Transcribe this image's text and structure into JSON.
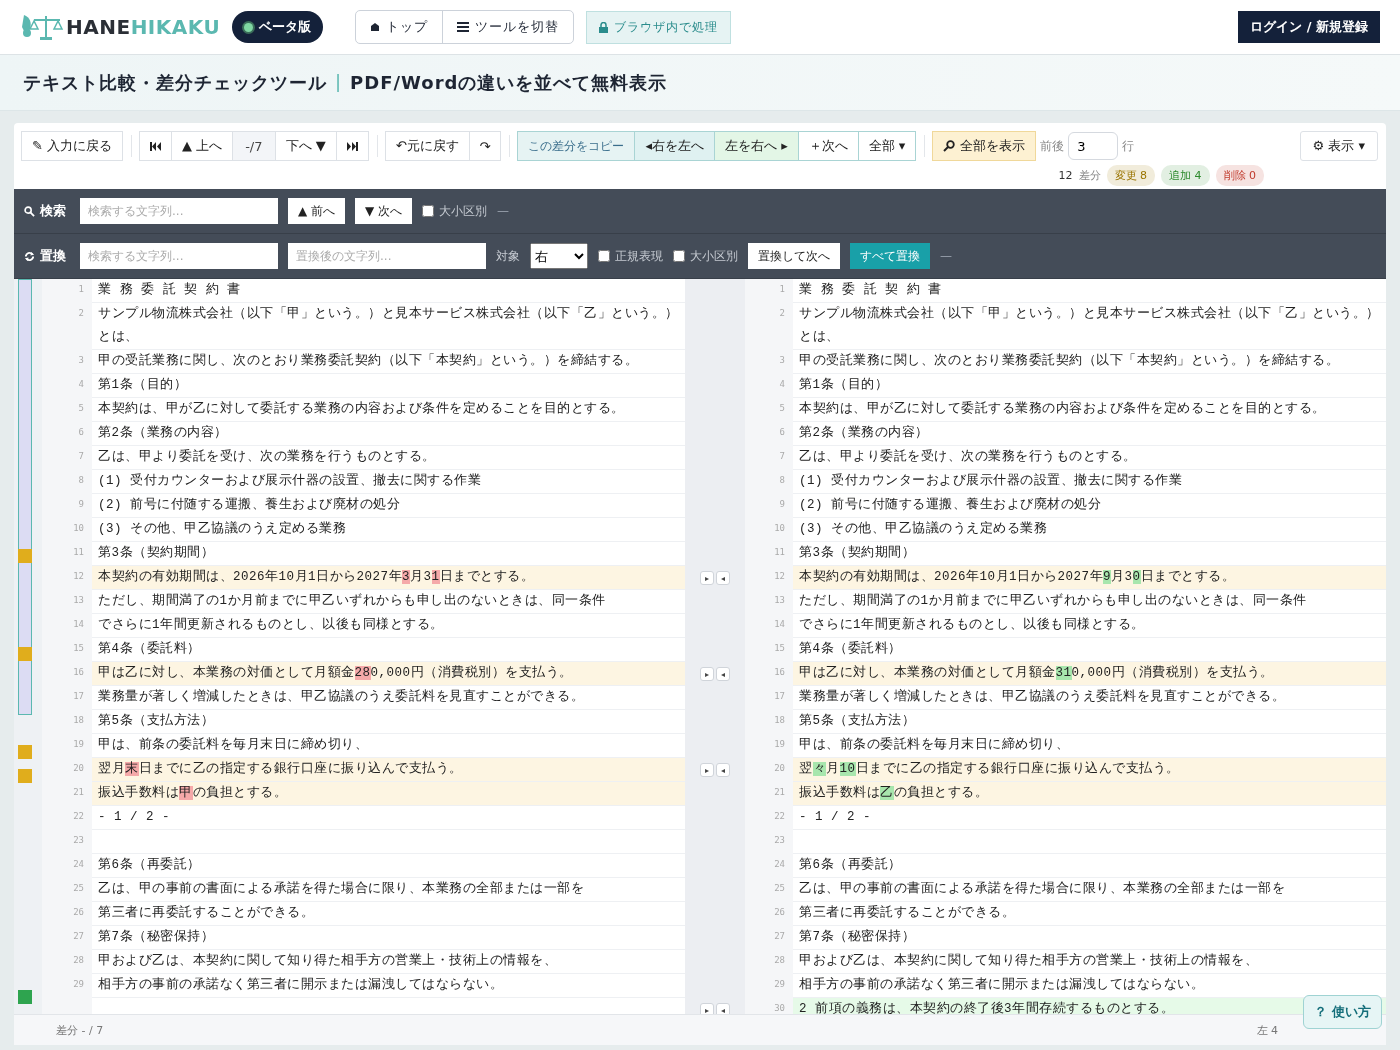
{
  "header": {
    "logo_dark": "HANE",
    "logo_teal": "HIKAKU",
    "beta": "ベータ版",
    "nav": [
      {
        "label": "トップ"
      },
      {
        "label": "ツールを切替"
      }
    ],
    "privacy": "ブラウザ内で処理",
    "login": "ログイン / 新規登録"
  },
  "title": {
    "main": "テキスト比較・差分チェックツール",
    "separator": "|",
    "sub": "PDF/Wordの違いを並べて無料表示"
  },
  "toolbar": {
    "groups": [
      [
        {
          "label": "✎ 入力に戻る",
          "kind": "plain"
        }
      ],
      [
        {
          "kind": "first"
        },
        {
          "label": "▲ 上へ",
          "kind": "plain"
        },
        {
          "label": "-/7",
          "kind": "counter"
        },
        {
          "label": "下へ ▼",
          "kind": "plain"
        },
        {
          "kind": "last"
        }
      ],
      [
        {
          "label": "↶元に戻す",
          "kind": "plain"
        },
        {
          "label": "↷",
          "kind": "plain"
        }
      ],
      [
        {
          "label": "この差分をコピー",
          "kind": "caption"
        },
        {
          "label": "◂右を左へ",
          "kind": "to-left"
        },
        {
          "label": "左を右へ ▸",
          "kind": "to-right"
        },
        {
          "label": "＋次へ",
          "kind": "plain"
        },
        {
          "label": "全部 ▾",
          "kind": "plain"
        }
      ],
      [
        {
          "label": "全部を表示",
          "kind": "accent"
        }
      ]
    ],
    "context": {
      "label": "前後",
      "value": "3",
      "unit": "行"
    },
    "display": "⚙ 表示 ▾",
    "total": "12",
    "total_label": "差分",
    "badges": [
      {
        "label": "変更 8",
        "color": "#9a7400"
      },
      {
        "label": "追加 4",
        "color": "#2e8b2e"
      },
      {
        "label": "削除 0",
        "color": "#c0392b"
      }
    ]
  },
  "search": {
    "label": "検索",
    "placeholder": "検索する文字列...",
    "prev": "▲ 前へ",
    "next": "▼ 次へ",
    "options": [
      {
        "label": "大小区別",
        "checked": false
      }
    ],
    "status": "—"
  },
  "replace": {
    "label": "置換",
    "find_placeholder": "検索する文字列...",
    "replace_placeholder": "置換後の文字列...",
    "target_label": "対象",
    "target": "右",
    "options": [
      {
        "label": "正規表現",
        "checked": false
      },
      {
        "label": "大小区別",
        "checked": false
      }
    ],
    "replace_next": "置換して次へ",
    "replace_all": "すべて置換",
    "status": "—"
  },
  "sync_buttons": {
    "to_right": "▸",
    "to_left": "◂"
  },
  "rows": [
    {
      "kind": "same",
      "left": {
        "num": "1",
        "text": "業 務 委 託 契 約 書"
      },
      "right": {
        "num": "1",
        "text": "業 務 委 託 契 約 書"
      }
    },
    {
      "kind": "same",
      "left": {
        "num": "2",
        "text": "サンプル物流株式会社（以下「甲」という。）と見本サービス株式会社（以下「乙」という。）とは、"
      },
      "right": {
        "num": "2",
        "text": "サンプル物流株式会社（以下「甲」という。）と見本サービス株式会社（以下「乙」という。）とは、"
      }
    },
    {
      "kind": "same",
      "left": {
        "num": "3",
        "text": "甲の受託業務に関し、次のとおり業務委託契約（以下「本契約」という。）を締結する。"
      },
      "right": {
        "num": "3",
        "text": "甲の受託業務に関し、次のとおり業務委託契約（以下「本契約」という。）を締結する。"
      }
    },
    {
      "kind": "same",
      "left": {
        "num": "4",
        "text": "第1条（目的）"
      },
      "right": {
        "num": "4",
        "text": "第1条（目的）"
      }
    },
    {
      "kind": "same",
      "left": {
        "num": "5",
        "text": "本契約は、甲が乙に対して委託する業務の内容および条件を定めることを目的とする。"
      },
      "right": {
        "num": "5",
        "text": "本契約は、甲が乙に対して委託する業務の内容および条件を定めることを目的とする。"
      }
    },
    {
      "kind": "same",
      "left": {
        "num": "6",
        "text": "第2条（業務の内容）"
      },
      "right": {
        "num": "6",
        "text": "第2条（業務の内容）"
      }
    },
    {
      "kind": "same",
      "left": {
        "num": "7",
        "text": "乙は、甲より委託を受け、次の業務を行うものとする。"
      },
      "right": {
        "num": "7",
        "text": "乙は、甲より委託を受け、次の業務を行うものとする。"
      }
    },
    {
      "kind": "same",
      "left": {
        "num": "8",
        "text": "(1) 受付カウンターおよび展示什器の設置、撤去に関する作業"
      },
      "right": {
        "num": "8",
        "text": "(1) 受付カウンターおよび展示什器の設置、撤去に関する作業"
      }
    },
    {
      "kind": "same",
      "left": {
        "num": "9",
        "text": "(2) 前号に付随する運搬、養生および廃材の処分"
      },
      "right": {
        "num": "9",
        "text": "(2) 前号に付随する運搬、養生および廃材の処分"
      }
    },
    {
      "kind": "same",
      "left": {
        "num": "10",
        "text": "(3) その他、甲乙協議のうえ定める業務"
      },
      "right": {
        "num": "10",
        "text": "(3) その他、甲乙協議のうえ定める業務"
      }
    },
    {
      "kind": "same",
      "left": {
        "num": "11",
        "text": "第3条（契約期間）"
      },
      "right": {
        "num": "11",
        "text": "第3条（契約期間）"
      }
    },
    {
      "kind": "changed",
      "left": {
        "num": "12",
        "segments": [
          {
            "text": "本契約の有効期間は、2026年10月1日から2027年",
            "changed": false
          },
          {
            "text": "3",
            "changed": true
          },
          {
            "text": "月3",
            "changed": false
          },
          {
            "text": "1",
            "changed": true
          },
          {
            "text": "日までとする。",
            "changed": false
          }
        ]
      },
      "right": {
        "num": "12",
        "segments": [
          {
            "text": "本契約の有効期間は、2026年10月1日から2027年",
            "changed": false
          },
          {
            "text": "9",
            "changed": true
          },
          {
            "text": "月3",
            "changed": false
          },
          {
            "text": "0",
            "changed": true
          },
          {
            "text": "日までとする。",
            "changed": false
          }
        ]
      }
    },
    {
      "kind": "same",
      "left": {
        "num": "13",
        "text": "ただし、期間満了の1か月前までに甲乙いずれからも申し出のないときは、同一条件"
      },
      "right": {
        "num": "13",
        "text": "ただし、期間満了の1か月前までに甲乙いずれからも申し出のないときは、同一条件"
      }
    },
    {
      "kind": "same",
      "left": {
        "num": "14",
        "text": "でさらに1年間更新されるものとし、以後も同様とする。"
      },
      "right": {
        "num": "14",
        "text": "でさらに1年間更新されるものとし、以後も同様とする。"
      }
    },
    {
      "kind": "same",
      "left": {
        "num": "15",
        "text": "第4条（委託料）"
      },
      "right": {
        "num": "15",
        "text": "第4条（委託料）"
      }
    },
    {
      "kind": "changed",
      "left": {
        "num": "16",
        "segments": [
          {
            "text": "甲は乙に対し、本業務の対価として月額金",
            "changed": false
          },
          {
            "text": "28",
            "changed": true
          },
          {
            "text": "0,000円（消費税別）を支払う。",
            "changed": false
          }
        ]
      },
      "right": {
        "num": "16",
        "segments": [
          {
            "text": "甲は乙に対し、本業務の対価として月額金",
            "changed": false
          },
          {
            "text": "31",
            "changed": true
          },
          {
            "text": "0,000円（消費税別）を支払う。",
            "changed": false
          }
        ]
      }
    },
    {
      "kind": "same",
      "left": {
        "num": "17",
        "text": "業務量が著しく増減したときは、甲乙協議のうえ委託料を見直すことができる。"
      },
      "right": {
        "num": "17",
        "text": "業務量が著しく増減したときは、甲乙協議のうえ委託料を見直すことができる。"
      }
    },
    {
      "kind": "same",
      "left": {
        "num": "18",
        "text": "第5条（支払方法）"
      },
      "right": {
        "num": "18",
        "text": "第5条（支払方法）"
      }
    },
    {
      "kind": "same",
      "left": {
        "num": "19",
        "text": "甲は、前条の委託料を毎月末日に締め切り、"
      },
      "right": {
        "num": "19",
        "text": "甲は、前条の委託料を毎月末日に締め切り、"
      }
    },
    {
      "kind": "changed",
      "left": {
        "num": "20",
        "segments": [
          {
            "text": "翌月",
            "changed": false
          },
          {
            "text": "末",
            "changed": true
          },
          {
            "text": "日までに乙の指定する銀行口座に振り込んで支払う。",
            "changed": false
          }
        ]
      },
      "right": {
        "num": "20",
        "segments": [
          {
            "text": "翌",
            "changed": false
          },
          {
            "text": "々",
            "changed": true
          },
          {
            "text": "月",
            "changed": false
          },
          {
            "text": "10",
            "changed": true
          },
          {
            "text": "日までに乙の指定する銀行口座に振り込んで支払う。",
            "changed": false
          }
        ]
      }
    },
    {
      "kind": "changed",
      "left": {
        "num": "21",
        "segments": [
          {
            "text": "振込手数料は",
            "changed": false
          },
          {
            "text": "甲",
            "changed": true
          },
          {
            "text": "の負担とする。",
            "changed": false
          }
        ]
      },
      "right": {
        "num": "21",
        "segments": [
          {
            "text": "振込手数料は",
            "changed": false
          },
          {
            "text": "乙",
            "changed": true
          },
          {
            "text": "の負担とする。",
            "changed": false
          }
        ]
      }
    },
    {
      "kind": "same",
      "left": {
        "num": "22",
        "text": "- 1 / 2 -"
      },
      "right": {
        "num": "22",
        "text": "- 1 / 2 -"
      }
    },
    {
      "kind": "same",
      "left": {
        "num": "23"
      },
      "right": {
        "num": "23"
      }
    },
    {
      "kind": "same",
      "left": {
        "num": "24",
        "text": "第6条（再委託）"
      },
      "right": {
        "num": "24",
        "text": "第6条（再委託）"
      }
    },
    {
      "kind": "same",
      "left": {
        "num": "25",
        "text": "乙は、甲の事前の書面による承諾を得た場合に限り、本業務の全部または一部を"
      },
      "right": {
        "num": "25",
        "text": "乙は、甲の事前の書面による承諾を得た場合に限り、本業務の全部または一部を"
      }
    },
    {
      "kind": "same",
      "left": {
        "num": "26",
        "text": "第三者に再委託することができる。"
      },
      "right": {
        "num": "26",
        "text": "第三者に再委託することができる。"
      }
    },
    {
      "kind": "same",
      "left": {
        "num": "27",
        "text": "第7条（秘密保持）"
      },
      "right": {
        "num": "27",
        "text": "第7条（秘密保持）"
      }
    },
    {
      "kind": "same",
      "left": {
        "num": "28",
        "text": "甲および乙は、本契約に関して知り得た相手方の営業上・技術上の情報を、"
      },
      "right": {
        "num": "28",
        "text": "甲および乙は、本契約に関して知り得た相手方の営業上・技術上の情報を、"
      }
    },
    {
      "kind": "same",
      "left": {
        "num": "29",
        "text": "相手方の事前の承諾なく第三者に開示または漏洩してはならない。"
      },
      "right": {
        "num": "29",
        "text": "相手方の事前の承諾なく第三者に開示または漏洩してはならない。"
      }
    },
    {
      "kind": "added",
      "right": {
        "num": "30",
        "text": "2 前項の義務は、本契約の終了後3年間存続するものとする。"
      }
    }
  ],
  "footer": {
    "left": "差分 - / 7",
    "right": "左 4"
  },
  "help": "？ 使い方"
}
